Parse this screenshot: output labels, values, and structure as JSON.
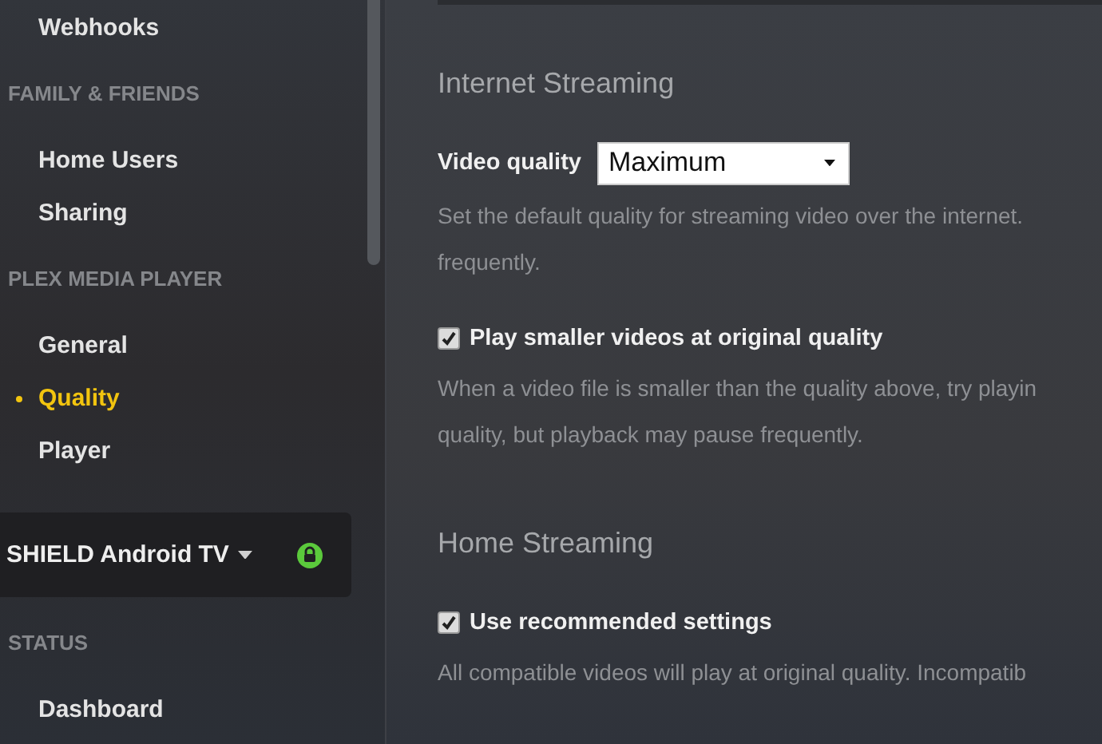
{
  "sidebar": {
    "items": [
      {
        "kind": "link",
        "label": "Webhooks",
        "selected": false
      },
      {
        "kind": "heading",
        "label": "FAMILY & FRIENDS"
      },
      {
        "kind": "link",
        "label": "Home Users",
        "selected": false
      },
      {
        "kind": "link",
        "label": "Sharing",
        "selected": false
      },
      {
        "kind": "heading",
        "label": "PLEX MEDIA PLAYER"
      },
      {
        "kind": "link",
        "label": "General",
        "selected": false
      },
      {
        "kind": "link",
        "label": "Quality",
        "selected": true
      },
      {
        "kind": "link",
        "label": "Player",
        "selected": false
      },
      {
        "kind": "device",
        "label": "SHIELD Android TV"
      },
      {
        "kind": "heading",
        "label": "STATUS"
      },
      {
        "kind": "link",
        "label": "Dashboard",
        "selected": false
      }
    ]
  },
  "sections": [
    {
      "title": "Internet Streaming",
      "settings": [
        {
          "kind": "select",
          "label": "Video quality",
          "value": "Maximum",
          "description": [
            "Set the default quality for streaming video over the internet.",
            "frequently."
          ]
        },
        {
          "kind": "checkbox",
          "label": "Play smaller videos at original quality",
          "checked": true,
          "description": [
            "When a video file is smaller than the quality above, try playin",
            "quality, but playback may pause frequently."
          ]
        }
      ]
    },
    {
      "title": "Home Streaming",
      "settings": [
        {
          "kind": "checkbox",
          "label": "Use recommended settings",
          "checked": true,
          "description": [
            "All compatible videos will play at original quality. Incompatib"
          ]
        }
      ]
    }
  ]
}
